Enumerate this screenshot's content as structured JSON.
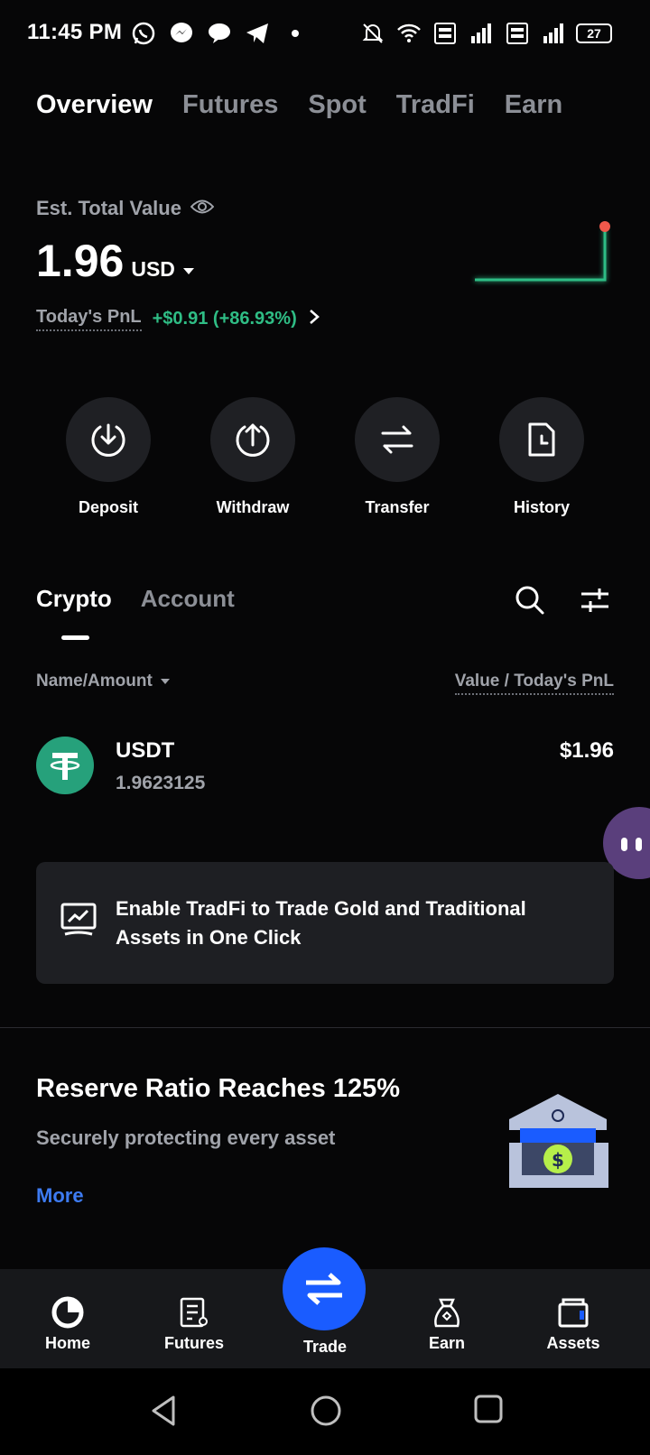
{
  "status_bar": {
    "time": "11:45 PM",
    "battery": "27",
    "left_icons": [
      "whatsapp-icon",
      "messenger-icon",
      "chat-bubble-icon",
      "telegram-icon",
      "dot-icon"
    ],
    "right_icons": [
      "bell-muted-icon",
      "wifi-icon",
      "volte-icon",
      "signal-icon",
      "volte-icon",
      "signal-icon",
      "battery-icon"
    ]
  },
  "top_tabs": [
    "Overview",
    "Futures",
    "Spot",
    "TradFi",
    "Earn"
  ],
  "overview": {
    "est_label": "Est. Total Value",
    "total_value": "1.96",
    "currency": "USD",
    "pnl_label": "Today's PnL",
    "pnl_value": "+$0.91 (+86.93%)",
    "spark_color": "#2fbd85",
    "spark_dot_color": "#f0584b"
  },
  "actions": [
    {
      "label": "Deposit",
      "icon": "download-arrow-icon"
    },
    {
      "label": "Withdraw",
      "icon": "upload-arrow-icon"
    },
    {
      "label": "Transfer",
      "icon": "transfer-arrows-icon"
    },
    {
      "label": "History",
      "icon": "history-document-icon"
    }
  ],
  "sub_tabs": [
    "Crypto",
    "Account"
  ],
  "list_header": {
    "left": "Name/Amount",
    "right": "Value / Today's PnL"
  },
  "assets": [
    {
      "symbol": "USDT",
      "amount": "1.9623125",
      "value": "$1.96",
      "color": "#26a17b"
    }
  ],
  "banner": {
    "text": "Enable TradFi to Trade Gold and Traditional Assets in One Click"
  },
  "reserve": {
    "title": "Reserve Ratio Reaches 125%",
    "subtitle": "Securely protecting every asset",
    "more": "More"
  },
  "bottom_nav": [
    {
      "label": "Home",
      "icon": "home-icon"
    },
    {
      "label": "Futures",
      "icon": "futures-icon"
    },
    {
      "label": "Trade",
      "icon": "trade-swap-icon"
    },
    {
      "label": "Earn",
      "icon": "earn-bag-icon"
    },
    {
      "label": "Assets",
      "icon": "wallet-icon"
    }
  ],
  "colors": {
    "background": "#060607",
    "positive": "#2fbd85",
    "link": "#3d7bf2",
    "trade_button": "#1a5cff"
  }
}
